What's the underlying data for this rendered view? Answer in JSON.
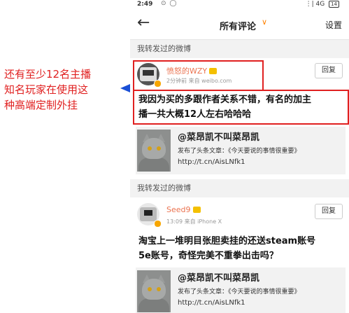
{
  "annotation": {
    "lines": [
      "还有至少12名主播",
      "知名玩家在使用这",
      "种高端定制外挂"
    ],
    "color": "#e02020"
  },
  "statusbar": {
    "time": "2:49",
    "network": "4G",
    "battery": "14"
  },
  "topbar": {
    "title": "所有评论",
    "settings": "设置",
    "back_icon": "back-arrow-icon",
    "dropdown_icon": "chevron-down-icon"
  },
  "posts": [
    {
      "section_label": "我转发过的微博",
      "username": "愤怒的WZY",
      "meta": "2分钟前 来自 weibo.com",
      "reply_label": "回复",
      "content_lines": [
        "我因为买的多跟作者关系不错，有名的加主",
        "播一共大概12人左右哈哈哈"
      ],
      "share": {
        "title": "@菜昂凯不叫菜昂凯",
        "line1": "发布了头条文章：《今天要说的事情很重要》",
        "line2": "http://t.cn/AisLNfk1"
      }
    },
    {
      "section_label": "我转发过的微博",
      "username": "Seed9",
      "meta": "13:09 来自 iPhone X",
      "reply_label": "回复",
      "content_lines": [
        "淘宝上一堆明目张胆卖挂的还送steam账号",
        "5e账号，奇怪完美不重拳出击吗？"
      ],
      "share": {
        "title": "@菜昂凯不叫菜昂凯",
        "line1": "发布了头条文章：《今天要说的事情很重要》",
        "line2": "http://t.cn/AisLNfk1"
      }
    }
  ],
  "colors": {
    "accent": "#ff8200",
    "username": "#eb7350",
    "highlight": "#e02020"
  }
}
